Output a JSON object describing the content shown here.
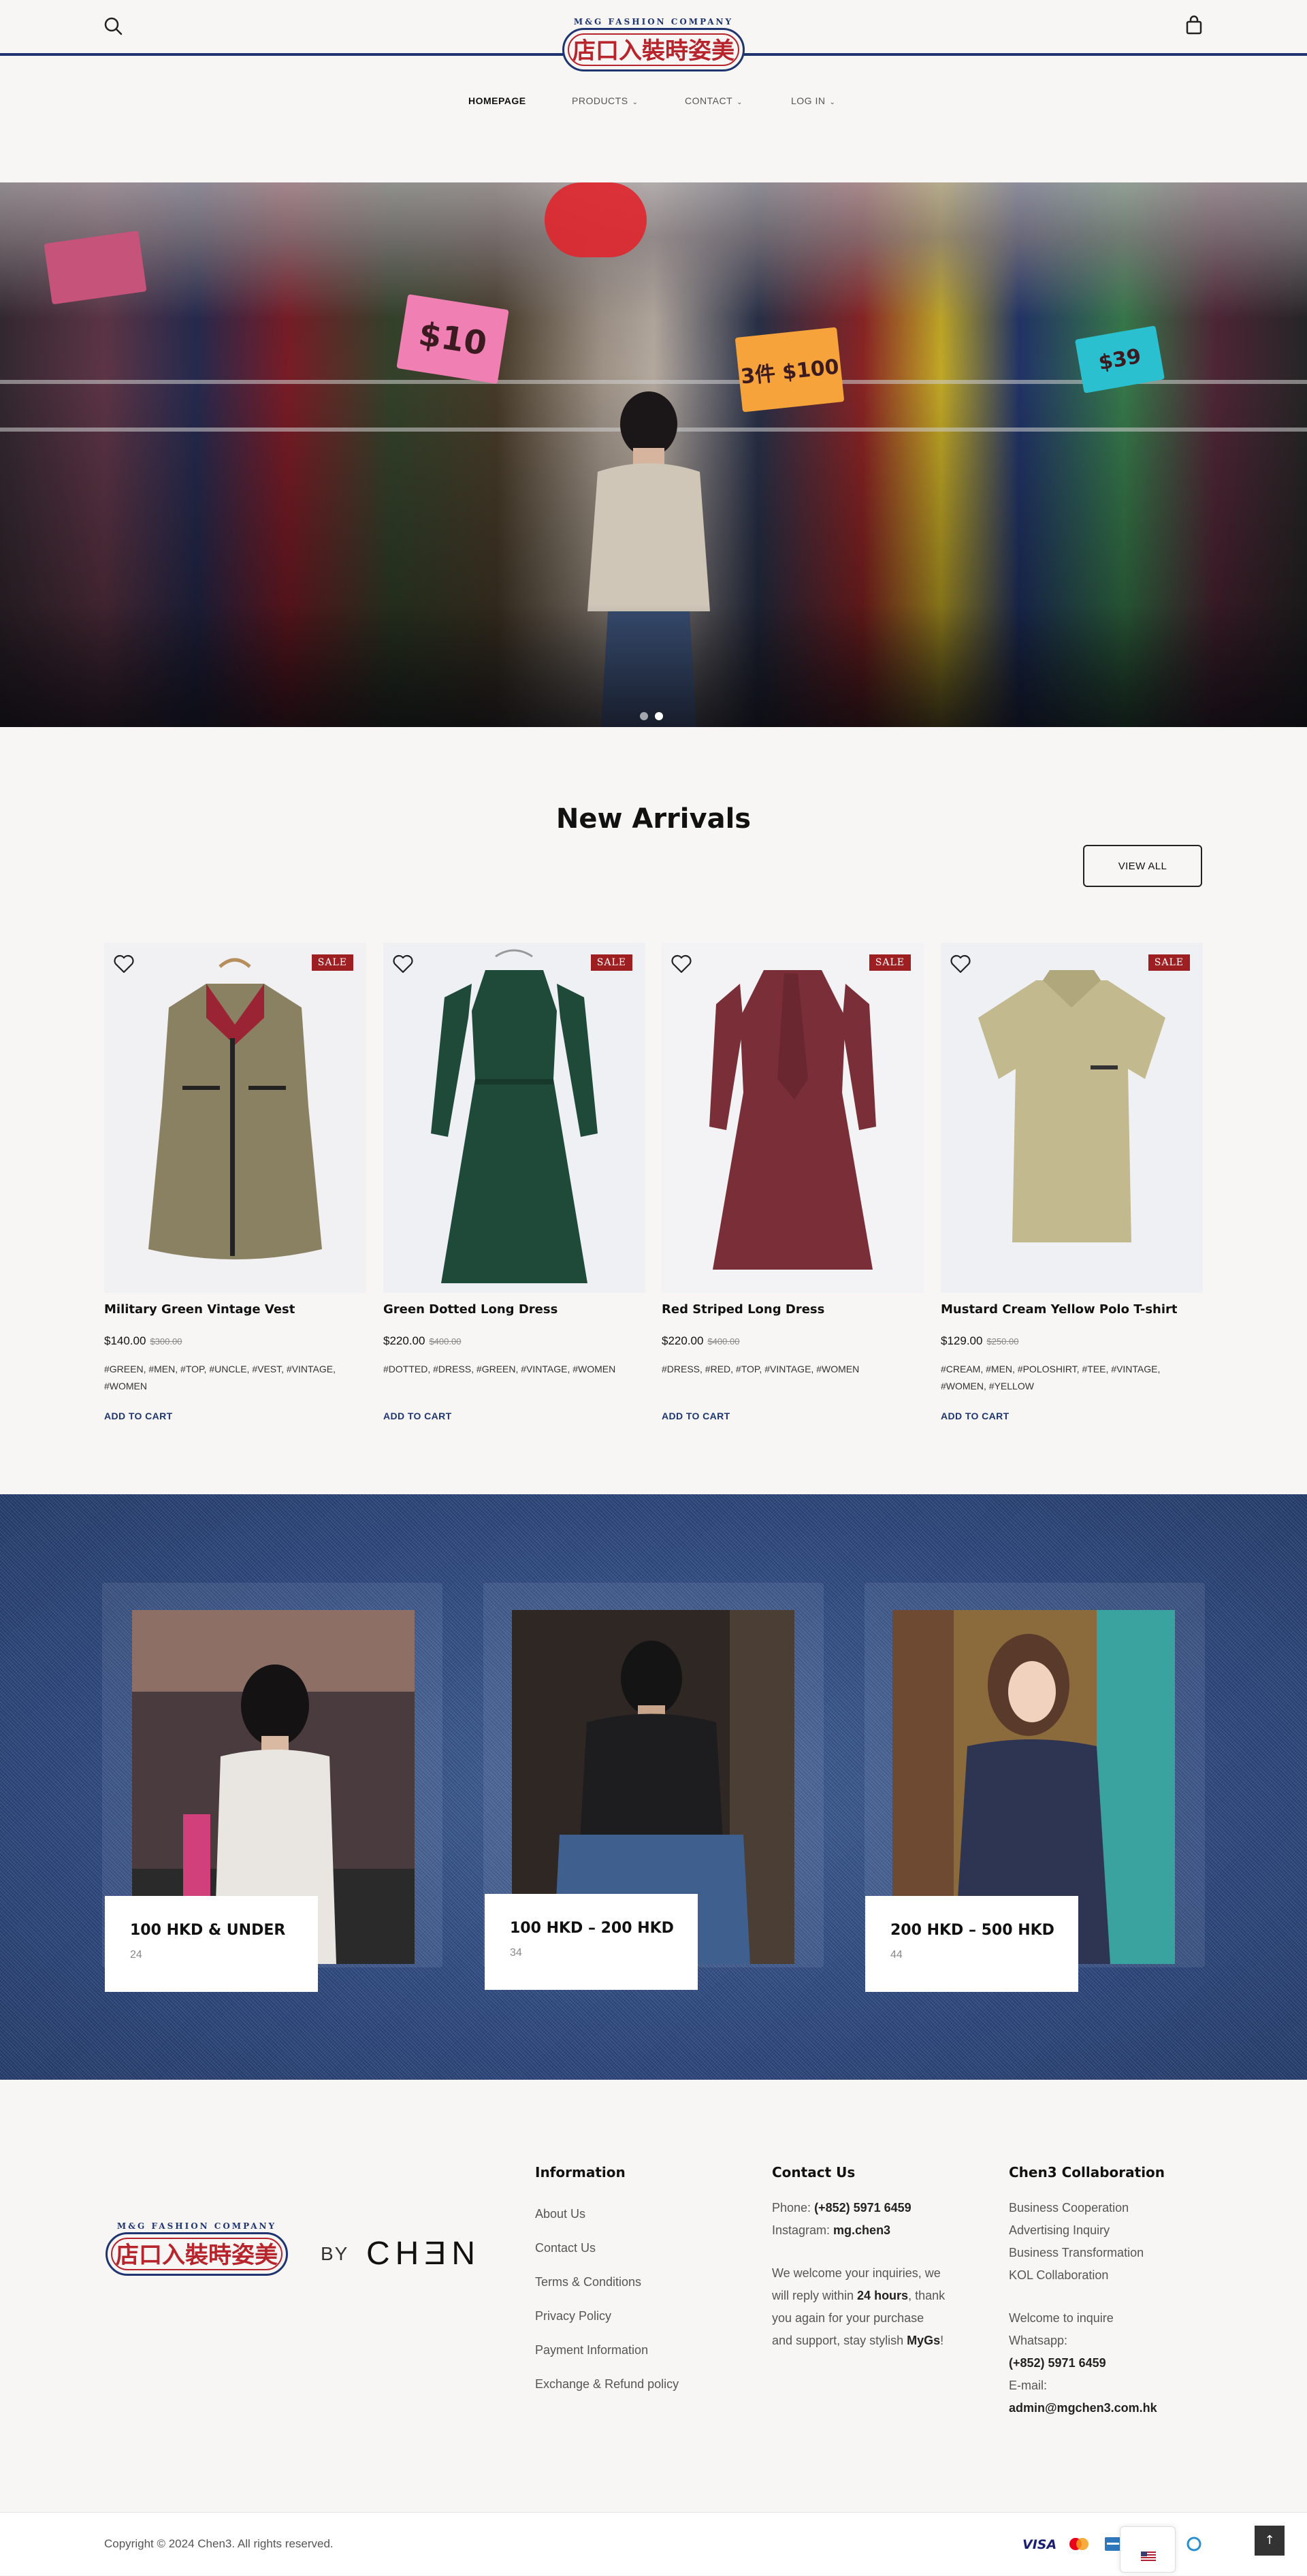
{
  "header": {
    "logo_top": "M&G FASHION COMPANY",
    "logo_text": "店口入裝時姿美",
    "nav": [
      {
        "label": "HOMEPAGE",
        "active": true
      },
      {
        "label": "PRODUCTS",
        "active": false
      },
      {
        "label": "CONTACT",
        "active": false
      },
      {
        "label": "LOG IN",
        "active": false
      }
    ],
    "icons": [
      "search-icon",
      "shopping-bag-icon",
      "chevron-down-icon"
    ]
  },
  "hero": {
    "sign_1": "$10",
    "sign_2": "3件 $100",
    "sign_3": "$39",
    "slides": 2,
    "active_slide": 2
  },
  "new_arrivals": {
    "title": "New Arrivals",
    "view_all": "VIEW ALL",
    "sale_badge": "SALE",
    "add_to_cart": "ADD TO CART",
    "products": [
      {
        "name": "Military Green Vintage Vest",
        "price": "$140.00",
        "old_price": "$300.00",
        "tags": "#GREEN, #MEN, #TOP, #UNCLE, #VEST, #VINTAGE, #WOMEN"
      },
      {
        "name": "Green Dotted Long Dress",
        "price": "$220.00",
        "old_price": "$400.00",
        "tags": "#DOTTED, #DRESS, #GREEN, #VINTAGE, #WOMEN"
      },
      {
        "name": "Red Striped Long Dress",
        "price": "$220.00",
        "old_price": "$400.00",
        "tags": "#DRESS, #RED, #TOP, #VINTAGE, #WOMEN"
      },
      {
        "name": "Mustard Cream Yellow Polo T-shirt",
        "price": "$129.00",
        "old_price": "$250.00",
        "tags": "#CREAM, #MEN, #POLOSHIRT, #TEE, #VINTAGE, #WOMEN, #YELLOW"
      }
    ]
  },
  "categories": [
    {
      "title": "100 HKD & UNDER",
      "count": "24"
    },
    {
      "title": "100 HKD – 200 HKD",
      "count": "34"
    },
    {
      "title": "200 HKD – 500 HKD",
      "count": "44"
    }
  ],
  "footer": {
    "by": "BY",
    "brand": "CHƎN",
    "information": {
      "heading": "Information",
      "links": [
        "About Us",
        "Contact Us",
        "Terms & Conditions",
        "Privacy Policy",
        "Payment Information",
        "Exchange & Refund policy"
      ]
    },
    "contact": {
      "heading": "Contact Us",
      "phone_label": "Phone: ",
      "phone": "(+852) 5971 6459",
      "instagram_label": "Instagram: ",
      "instagram": "mg.chen3",
      "msg_1": "We welcome your inquiries, we",
      "msg_2a": "will reply within ",
      "msg_2b": "24 hours",
      "msg_2c": ", thank",
      "msg_3": "you again for your purchase",
      "msg_4a": "and support, stay stylish ",
      "msg_4b": "MyGs",
      "msg_4c": "!"
    },
    "collab": {
      "heading": "Chen3 Collaboration",
      "items": [
        "Business Cooperation",
        "Advertising Inquiry",
        "Business Transformation",
        "KOL Collaboration"
      ],
      "inquire": "Welcome to inquire",
      "whatsapp_label": "Whatsapp:",
      "whatsapp": "(+852) 5971 6459",
      "email_label": "E-mail:",
      "email": "admin@mgchen3.com.hk"
    },
    "copyright": "Copyright © 2024 Chen3. All rights reserved.",
    "payments": [
      "VISA",
      "mastercard",
      "amex",
      "unionpay"
    ],
    "lang_flag": "us-flag-icon",
    "to_top": "↑"
  },
  "colors": {
    "brand_navy": "#1f3570",
    "brand_red": "#b8242c",
    "sale_red": "#9e1f22"
  }
}
